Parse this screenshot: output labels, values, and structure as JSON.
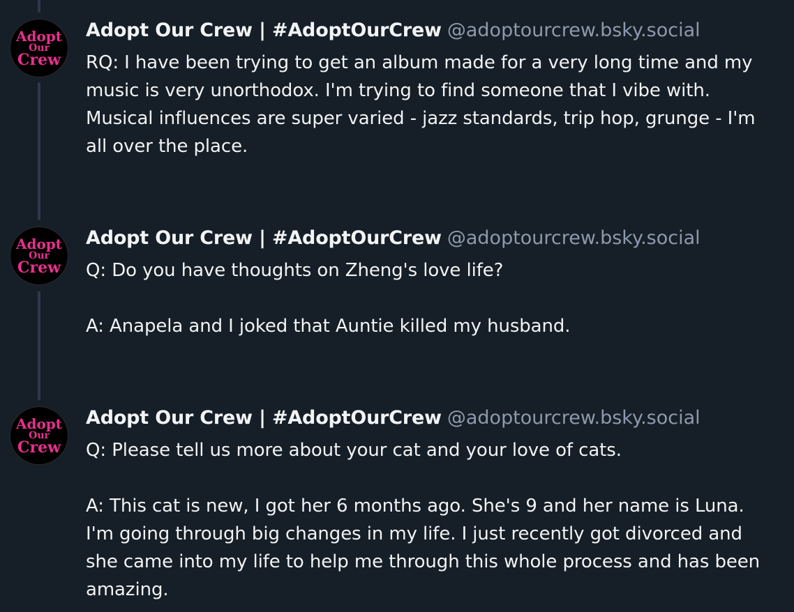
{
  "thread": {
    "posts": [
      {
        "author": {
          "display_name": "Adopt Our Crew | #AdoptOurCrew",
          "handle": "@adoptourcrew.bsky.social",
          "avatar_text": [
            "Adopt",
            "Our",
            "Crew"
          ],
          "avatar_color": "#e8308c"
        },
        "paragraphs": [
          "RQ: I have been trying to get an album made for a very long time and my music is very unorthodox. I'm trying to find someone that I vibe with. Musical influences are super varied - jazz standards, trip hop, grunge - I'm all over the place."
        ]
      },
      {
        "author": {
          "display_name": "Adopt Our Crew | #AdoptOurCrew",
          "handle": "@adoptourcrew.bsky.social",
          "avatar_text": [
            "Adopt",
            "Our",
            "Crew"
          ],
          "avatar_color": "#e8308c"
        },
        "paragraphs": [
          "Q: Do you have thoughts on Zheng's love life?",
          "A: Anapela and I joked that Auntie killed my husband."
        ]
      },
      {
        "author": {
          "display_name": "Adopt Our Crew | #AdoptOurCrew",
          "handle": "@adoptourcrew.bsky.social",
          "avatar_text": [
            "Adopt",
            "Our",
            "Crew"
          ],
          "avatar_color": "#e8308c"
        },
        "paragraphs": [
          "Q: Please tell us more about your cat and your love of cats.",
          "A: This cat is new, I got her 6 months ago. She's 9 and her name is Luna. I'm going through big changes in my life. I just recently got divorced and she came into my life to help me through this whole process and has been amazing."
        ]
      }
    ]
  },
  "colors": {
    "background": "#161e27",
    "thread_line": "#2d3a4a",
    "text_primary": "#f1f3f5",
    "text_secondary": "#8d9aad",
    "avatar_text": "#e8308c"
  }
}
